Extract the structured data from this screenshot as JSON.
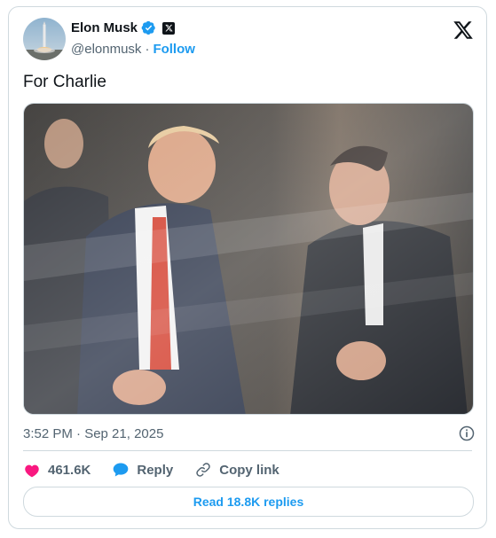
{
  "author": {
    "name": "Elon Musk",
    "handle": "@elonmusk",
    "separator": "·",
    "follow_label": "Follow"
  },
  "tweet": {
    "text": "For Charlie",
    "timestamp": "3:52 PM · Sep 21, 2025"
  },
  "actions": {
    "likes": "461.6K",
    "reply_label": "Reply",
    "copy_link_label": "Copy link"
  },
  "read_replies_label": "Read 18.8K replies",
  "colors": {
    "accent": "#1d9bf0",
    "like": "#f91880",
    "text": "#0f1419",
    "secondary_text": "#536471",
    "border": "#cfd9de"
  },
  "icons": {
    "verified": "verified-badge-icon",
    "x_logo": "x-logo-icon",
    "info": "info-icon",
    "like": "heart-icon",
    "reply": "reply-bubble-icon",
    "copy_link": "link-icon"
  }
}
